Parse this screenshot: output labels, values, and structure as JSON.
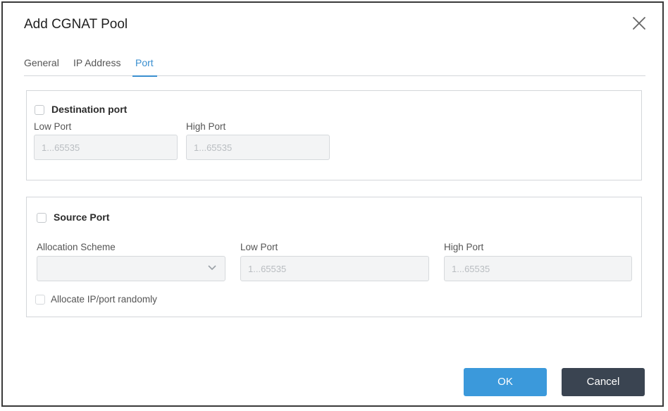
{
  "dialog": {
    "title": "Add CGNAT Pool",
    "close_icon": "close-icon"
  },
  "tabs": [
    {
      "label": "General",
      "active": false
    },
    {
      "label": "IP Address",
      "active": false
    },
    {
      "label": "Port",
      "active": true
    }
  ],
  "destination": {
    "checkbox_label": "Destination port",
    "checked": false,
    "low_label": "Low Port",
    "low_placeholder": "1...65535",
    "high_label": "High Port",
    "high_placeholder": "1...65535"
  },
  "source": {
    "checkbox_label": "Source Port",
    "checked": false,
    "scheme_label": "Allocation Scheme",
    "scheme_value": "",
    "low_label": "Low Port",
    "low_placeholder": "1...65535",
    "high_label": "High Port",
    "high_placeholder": "1...65535",
    "random_label": "Allocate IP/port randomly",
    "random_checked": false
  },
  "buttons": {
    "ok": "OK",
    "cancel": "Cancel"
  },
  "colors": {
    "accent": "#3a8fd0",
    "ok_button": "#3b99db",
    "cancel_button": "#3a4451"
  }
}
